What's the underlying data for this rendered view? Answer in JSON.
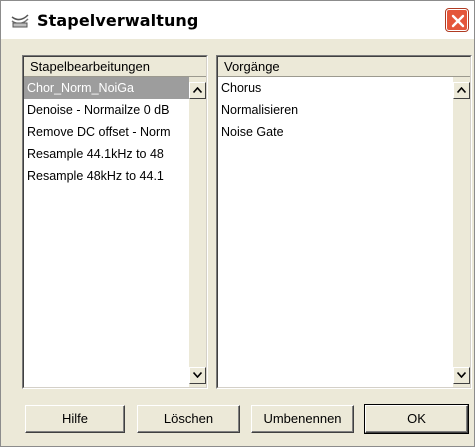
{
  "window": {
    "title": "Stapelverwaltung",
    "colors": {
      "face": "#ece9d8",
      "selection": "#9d9d9d",
      "close": "#e4563a"
    }
  },
  "left_panel": {
    "header": "Stapelbearbeitungen",
    "items": [
      "Chor_Norm_NoiGa",
      "Denoise - Normailze 0 dB",
      "Remove DC offset - Norm",
      "Resample 44.1kHz to 48",
      "Resample 48kHz to 44.1"
    ],
    "selected_index": 0
  },
  "right_panel": {
    "header": "Vorgänge",
    "items": [
      "Chorus",
      "Normalisieren",
      "Noise Gate"
    ]
  },
  "buttons": {
    "help": "Hilfe",
    "delete": "Löschen",
    "rename": "Umbenennen",
    "ok": "OK"
  },
  "icons": {
    "title": "batch-icon",
    "close": "close-icon",
    "scroll_up": "arrow-up-icon",
    "scroll_down": "arrow-down-icon"
  }
}
